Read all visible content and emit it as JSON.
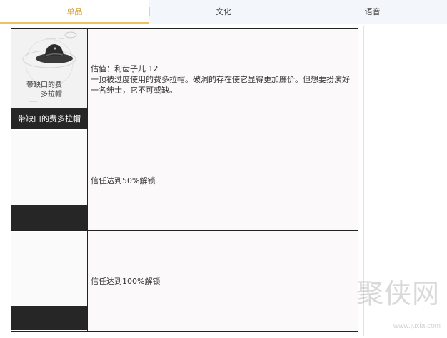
{
  "tabs": [
    {
      "label": "单品",
      "active": true
    },
    {
      "label": "文化",
      "active": false
    },
    {
      "label": "语音",
      "active": false
    }
  ],
  "items": [
    {
      "name": "带缺口的费多拉帽",
      "image_text": {
        "title": "带缺口的费",
        "subtitle": "多拉帽"
      },
      "description_lines": [
        "估值：利齿子儿 12",
        "一顶被过度使用的费多拉帽。破洞的存在使它显得更加廉价。但想要扮演好一名绅士，它不可或缺。"
      ]
    },
    {
      "name": "",
      "description_lines": [
        "信任达到50%解锁"
      ]
    },
    {
      "name": "",
      "description_lines": [
        "信任达到100%解锁"
      ]
    }
  ],
  "watermark": {
    "text": "聚侠网",
    "url": "www.juxia.com"
  },
  "colors": {
    "accent": "#d7a03b",
    "caption_bg": "#262626",
    "desc_bg": "#fbf9f9"
  }
}
